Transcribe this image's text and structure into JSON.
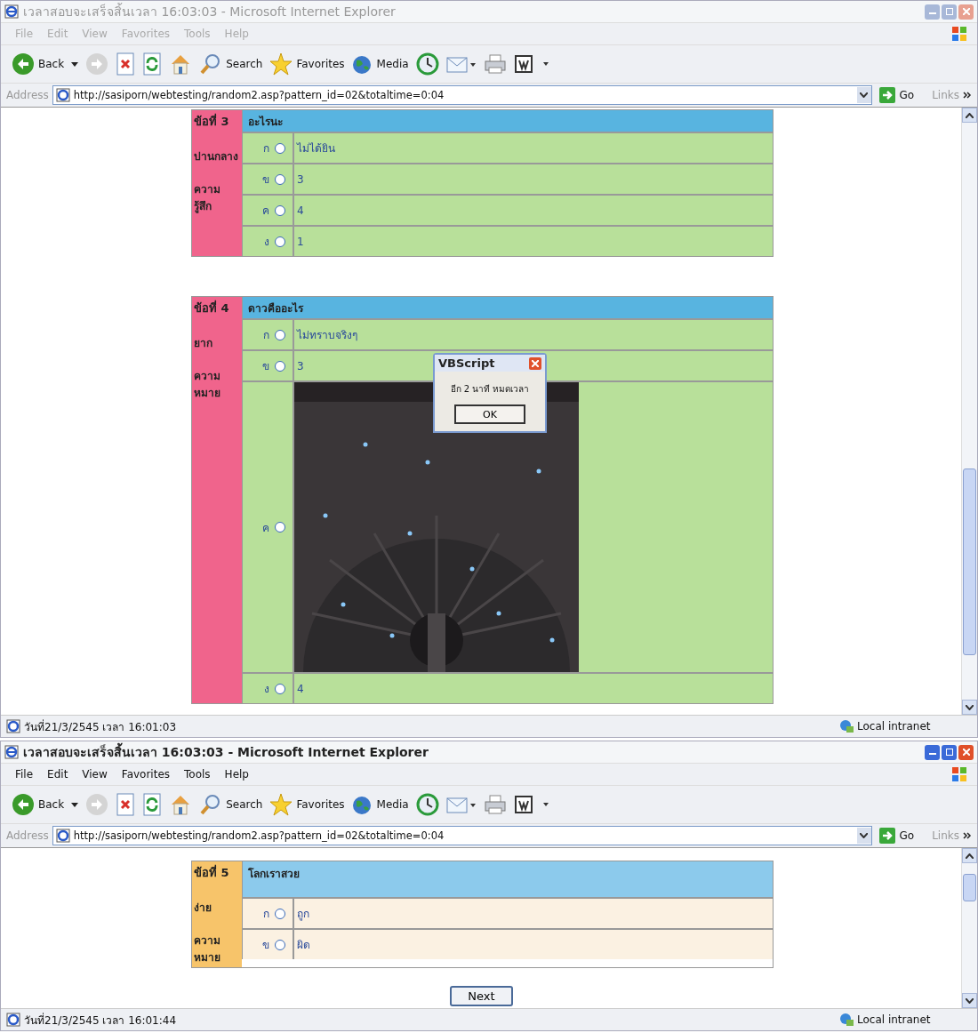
{
  "windows": [
    {
      "title": "เวลาสอบจะเสร็จสิ้นเวลา 16:03:03 - Microsoft Internet Explorer",
      "active": false,
      "menu": [
        "File",
        "Edit",
        "View",
        "Favorites",
        "Tools",
        "Help"
      ],
      "toolbar": [
        {
          "kind": "back",
          "label": "Back"
        },
        {
          "kind": "forward"
        },
        {
          "kind": "stop"
        },
        {
          "kind": "refresh"
        },
        {
          "kind": "home"
        },
        {
          "kind": "search",
          "label": "Search"
        },
        {
          "kind": "favorites",
          "label": "Favorites"
        },
        {
          "kind": "media",
          "label": "Media"
        },
        {
          "kind": "history"
        },
        {
          "kind": "mail"
        },
        {
          "kind": "print"
        },
        {
          "kind": "edit"
        }
      ],
      "address": {
        "label": "Address",
        "url": "http://sasiporn/webtesting/random2.asp?pattern_id=02&totaltime=0:04",
        "go": "Go",
        "links": "Links"
      },
      "questions": [
        {
          "number": "ข้อที่ 3",
          "prompt": "อะไรนะ",
          "level": "ปานกลาง",
          "category": "ความ รู้สึก",
          "color": "#f0648c",
          "options": [
            {
              "letter": "ก",
              "text": "ไม่ได้ยิน",
              "selected": false,
              "color": "#b8e09a"
            },
            {
              "letter": "ข",
              "text": "3",
              "selected": false,
              "color": "#b8e09a"
            },
            {
              "letter": "ค",
              "text": "4",
              "selected": false,
              "color": "#b8e09a"
            },
            {
              "letter": "ง",
              "text": "1",
              "selected": false,
              "color": "#b8e09a"
            }
          ]
        },
        {
          "number": "ข้อที่ 4",
          "prompt": "ดาวคืออะไร",
          "level": "ยาก",
          "category": "ความ หมาย",
          "color": "#f0648c",
          "options": [
            {
              "letter": "ก",
              "text": "ไม่ทราบจริงๆ",
              "selected": false,
              "color": "#b8e09a"
            },
            {
              "letter": "ข",
              "text": "3",
              "selected": false,
              "color": "#b8e09a"
            },
            {
              "letter": "ค",
              "kind": "picture",
              "selected": false,
              "color": "#b8e09a"
            },
            {
              "letter": "ง",
              "text": "4",
              "selected": false,
              "color": "#b8e09a"
            }
          ]
        }
      ],
      "dialog": {
        "title": "VBScript",
        "message": "อีก 2 นาที หมดเวลา",
        "button": "OK"
      },
      "status": "วันที่21/3/2545 เวลา 16:01:03",
      "zone": "Local intranet"
    },
    {
      "title": "เวลาสอบจะเสร็จสิ้นเวลา 16:03:03 - Microsoft Internet Explorer",
      "active": true,
      "menu": [
        "File",
        "Edit",
        "View",
        "Favorites",
        "Tools",
        "Help"
      ],
      "toolbar": [
        {
          "kind": "back",
          "label": "Back"
        },
        {
          "kind": "forward"
        },
        {
          "kind": "stop"
        },
        {
          "kind": "refresh"
        },
        {
          "kind": "home"
        },
        {
          "kind": "search",
          "label": "Search"
        },
        {
          "kind": "favorites",
          "label": "Favorites"
        },
        {
          "kind": "media",
          "label": "Media"
        },
        {
          "kind": "history"
        },
        {
          "kind": "mail"
        },
        {
          "kind": "print"
        },
        {
          "kind": "edit"
        }
      ],
      "address": {
        "label": "Address",
        "url": "http://sasiporn/webtesting/random2.asp?pattern_id=02&totaltime=0:04",
        "go": "Go",
        "links": "Links"
      },
      "questions": [
        {
          "number": "ข้อที่ 5",
          "prompt": "โลกเราสวย",
          "level": "ง่าย",
          "category": "ความ หมาย",
          "color": "#f7c46a",
          "options": [
            {
              "letter": "ก",
              "text": "ถูก",
              "selected": false,
              "color": "#fbf1e2"
            },
            {
              "letter": "ข",
              "text": "ผิด",
              "selected": false,
              "color": "#fbf1e2"
            }
          ]
        }
      ],
      "next_button": "Next",
      "status": "วันที่21/3/2545 เวลา 16:01:44",
      "zone": "Local intranet"
    }
  ]
}
